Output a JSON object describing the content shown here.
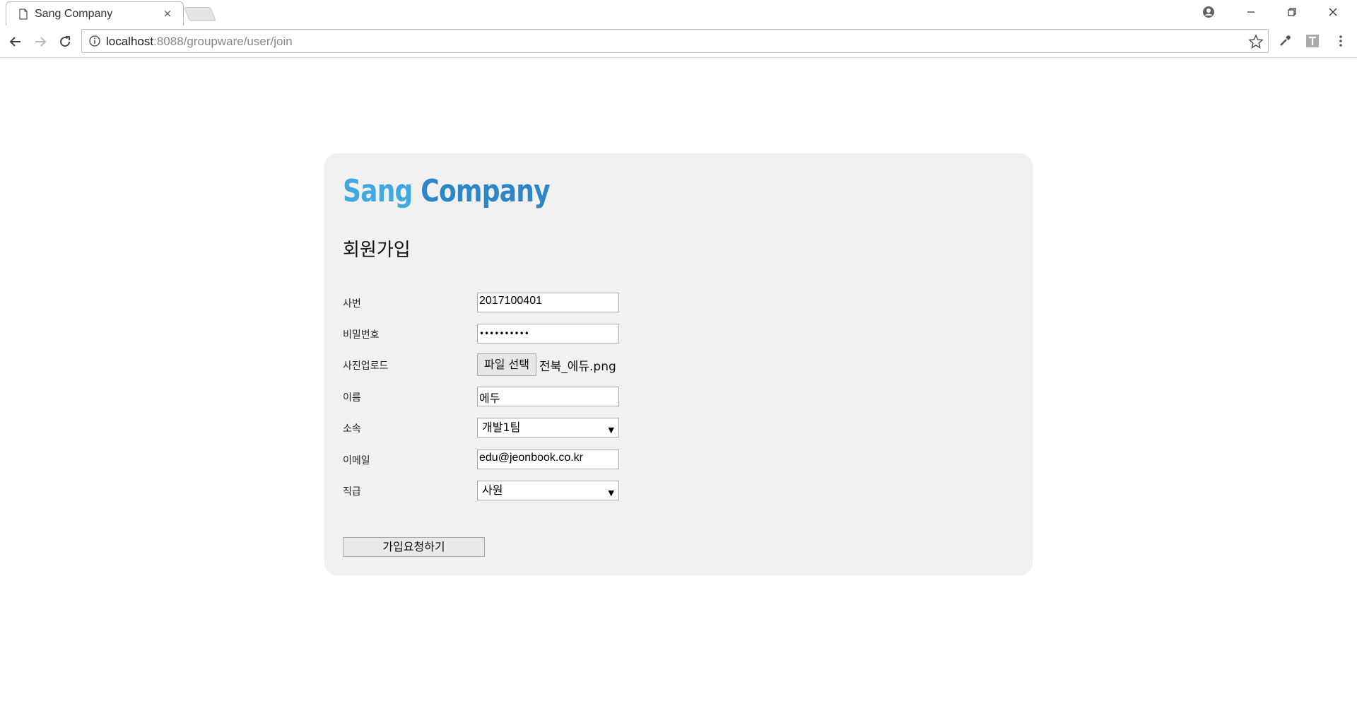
{
  "browser": {
    "tab_title": "Sang Company",
    "tab_close": "×",
    "url_host": "localhost",
    "url_path": ":8088/groupware/user/join"
  },
  "page": {
    "logo_part1": "Sang",
    "logo_part2": " Company",
    "heading": "회원가입",
    "fields": {
      "employee_no": {
        "label": "사번",
        "value": "2017100401"
      },
      "password": {
        "label": "비밀번호",
        "value": "••••••••••"
      },
      "photo": {
        "label": "사진업로드",
        "button": "파일 선택",
        "file_name": "전북_에듀.png"
      },
      "name": {
        "label": "이름",
        "value": "에두"
      },
      "department": {
        "label": "소속",
        "value": "개발1팀"
      },
      "email": {
        "label": "이메일",
        "value": "edu@jeonbook.co.kr"
      },
      "position": {
        "label": "직급",
        "value": "사원"
      }
    },
    "submit_label": "가입요청하기",
    "dropdown_arrow": "▼"
  },
  "colors": {
    "logo_light": "#3fa9e0",
    "logo_dark": "#2c86c7",
    "panel_bg": "#f1f1f1"
  }
}
